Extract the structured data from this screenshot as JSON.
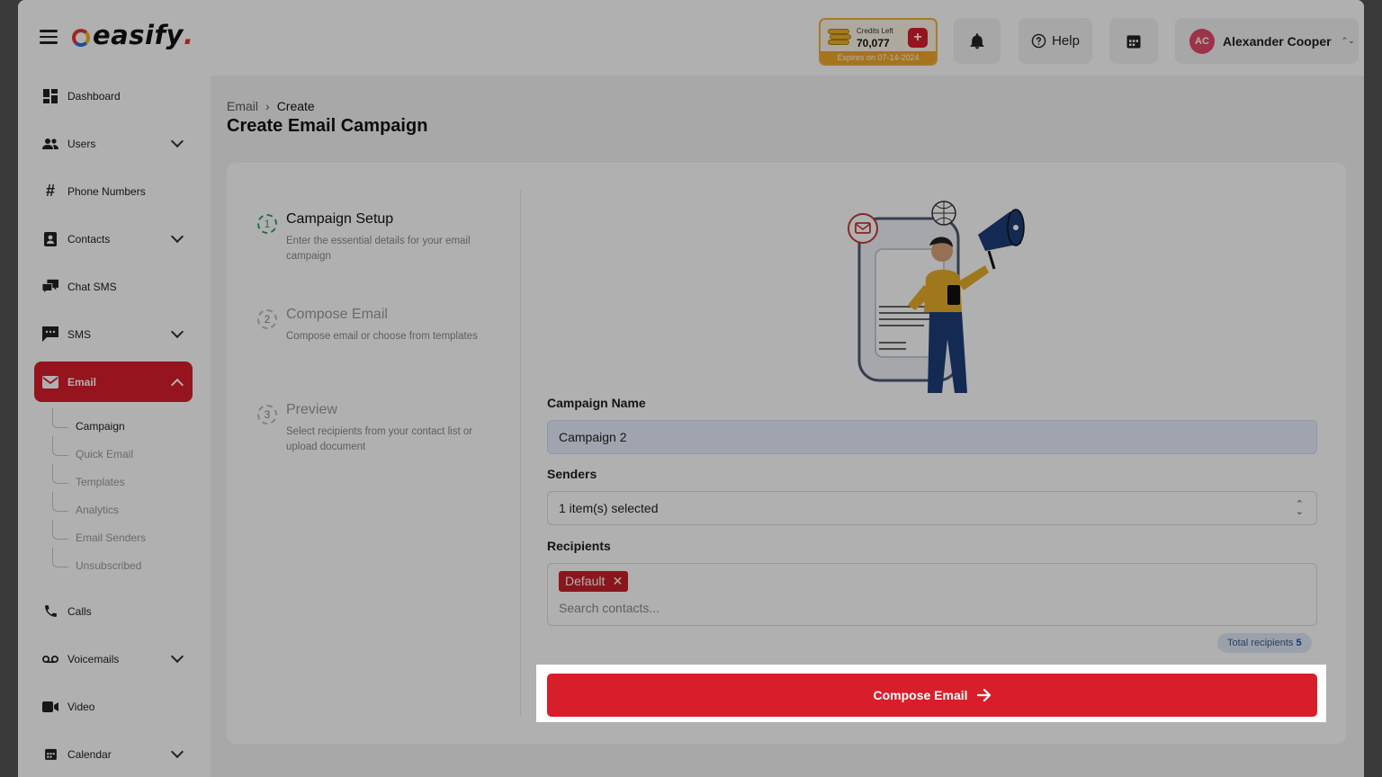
{
  "app": {
    "logo_text": "easify",
    "logo_dot": "."
  },
  "header": {
    "credits": {
      "label": "Credits Left",
      "value": "70,077",
      "add": "+",
      "expiry": "Expires on 07-14-2024"
    },
    "help_label": "Help",
    "user": {
      "initials": "AC",
      "name": "Alexander Cooper",
      "toggle": "⌃⌄"
    }
  },
  "sidebar": {
    "items": [
      {
        "label": "Dashboard"
      },
      {
        "label": "Users"
      },
      {
        "label": "Phone Numbers"
      },
      {
        "label": "Contacts"
      },
      {
        "label": "Chat SMS"
      },
      {
        "label": "SMS"
      },
      {
        "label": "Email"
      },
      {
        "label": "Calls"
      },
      {
        "label": "Voicemails"
      },
      {
        "label": "Video"
      },
      {
        "label": "Calendar"
      }
    ],
    "email_sub": [
      {
        "label": "Campaign"
      },
      {
        "label": "Quick Email"
      },
      {
        "label": "Templates"
      },
      {
        "label": "Analytics"
      },
      {
        "label": "Email Senders"
      },
      {
        "label": "Unsubscribed"
      }
    ]
  },
  "breadcrumb": {
    "parent": "Email",
    "separator": "›",
    "current": "Create"
  },
  "page_title": "Create Email Campaign",
  "steps": [
    {
      "num": "1",
      "title": "Campaign Setup",
      "desc": "Enter the essential details for your email campaign"
    },
    {
      "num": "2",
      "title": "Compose Email",
      "desc": "Compose email or choose from templates"
    },
    {
      "num": "3",
      "title": "Preview",
      "desc": "Select recipients from your contact list or upload document"
    }
  ],
  "form": {
    "campaign_name_label": "Campaign Name",
    "campaign_name_value": "Campaign 2",
    "senders_label": "Senders",
    "senders_value": "1 item(s) selected",
    "recipients_label": "Recipients",
    "recipient_tag": "Default",
    "recipient_tag_remove": "✕",
    "search_placeholder": "Search contacts...",
    "total_label": "Total recipients",
    "total_value": "5",
    "compose_button": "Compose Email"
  },
  "colors": {
    "accent": "#d81e2a",
    "step_active": "#2fa36b",
    "credits_border": "#f0b23a"
  }
}
